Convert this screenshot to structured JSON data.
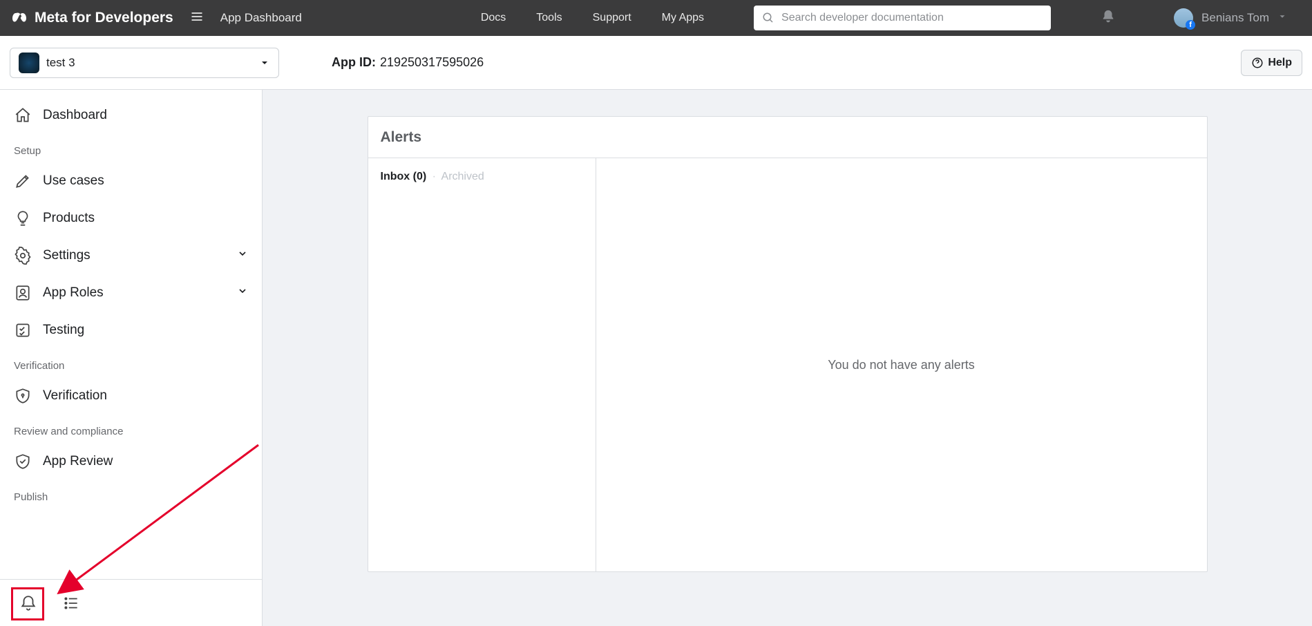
{
  "header": {
    "brand": "Meta for Developers",
    "crumb": "App Dashboard",
    "nav": {
      "docs": "Docs",
      "tools": "Tools",
      "support": "Support",
      "myapps": "My Apps"
    },
    "search_placeholder": "Search developer documentation",
    "user": "Benians Tom"
  },
  "appbar": {
    "app_name": "test 3",
    "appid_label": "App ID:",
    "appid_value": "219250317595026",
    "help": "Help"
  },
  "sidebar": {
    "dashboard": "Dashboard",
    "sect_setup": "Setup",
    "usecases": "Use cases",
    "products": "Products",
    "settings": "Settings",
    "approles": "App Roles",
    "testing": "Testing",
    "sect_verif": "Verification",
    "verification": "Verification",
    "sect_review": "Review and compliance",
    "appreview": "App Review",
    "sect_publish": "Publish"
  },
  "alerts": {
    "title": "Alerts",
    "inbox_label": "Inbox",
    "inbox_count": "(0)",
    "archived_label": "Archived",
    "empty": "You do not have any alerts"
  }
}
